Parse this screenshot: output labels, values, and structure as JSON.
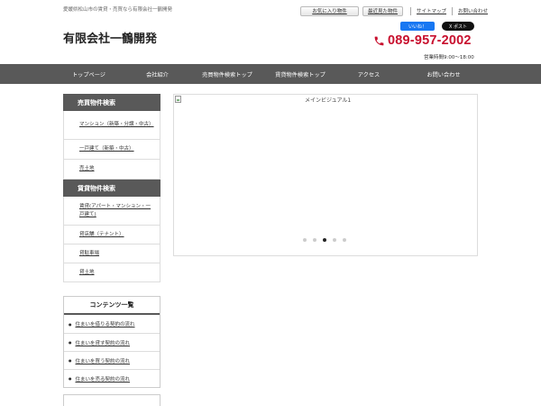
{
  "header": {
    "tagline": "愛媛県松山市の賃貸・売買なら有限会社一鶴開発",
    "logo": "有限会社一鶴開発",
    "links": {
      "favorites": "お気に入り物件",
      "recent": "最近見た物件",
      "sitemap": "サイトマップ",
      "contact": "お問い合わせ"
    },
    "social": {
      "facebook": "いいね！",
      "x": "X ポスト"
    },
    "phone": "089-957-2002",
    "hours": "営業時間9:00～18:00"
  },
  "nav": {
    "items": [
      "トップページ",
      "会社紹介",
      "売買物件検索トップ",
      "賃貸物件検索トップ",
      "アクセス",
      "お問い合わせ"
    ]
  },
  "sidebar": {
    "sale_title": "売買物件検索",
    "sale_items": [
      "マンション（新築・分譲・中古）",
      "一戸建て（新築・中古）",
      "売土地"
    ],
    "rent_title": "賃貸物件検索",
    "rent_items": [
      "賃貸(アパート・マンション・一戸建て)",
      "貸店舗（テナント）",
      "貸駐車場",
      "貸土地"
    ],
    "contents_title": "コンテンツ一覧",
    "contents_items": [
      "住まいを借りる契約の流れ",
      "住まいを貸す契約の流れ",
      "住まいを買う契約の流れ",
      "住まいを売る契約の流れ"
    ]
  },
  "main": {
    "visual_alt": "メインビジュアル1",
    "slider": {
      "count": 5,
      "active_index": 3
    }
  },
  "colors": {
    "nav_bg": "#595959",
    "phone": "#c8102e",
    "facebook": "#1877f2"
  }
}
